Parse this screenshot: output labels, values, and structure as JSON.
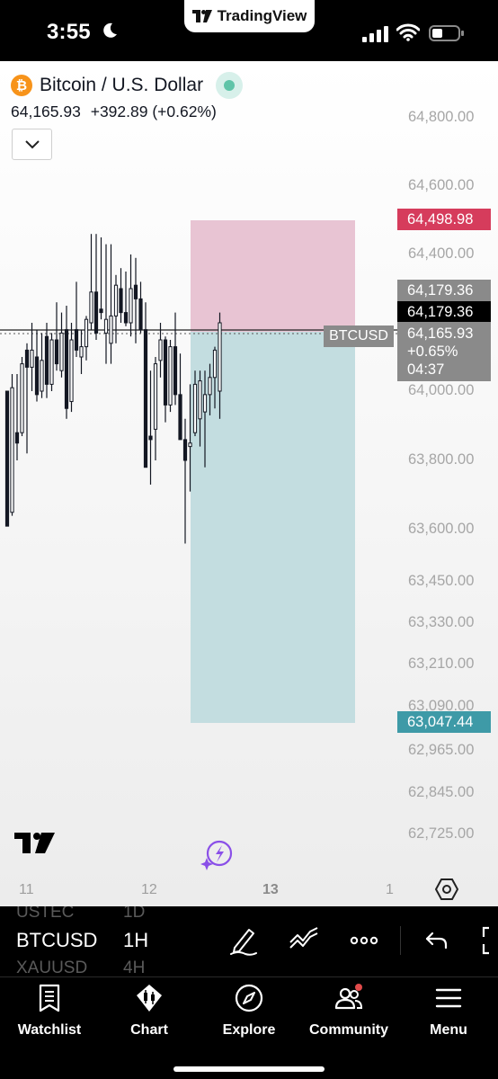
{
  "status_bar": {
    "time": "3:55",
    "app_pill": "TradingView"
  },
  "header": {
    "symbol_name": "Bitcoin / U.S. Dollar",
    "logo_char": "₿",
    "last_price": "64,165.93",
    "change": "+392.89",
    "change_pct": "(+0.62%)"
  },
  "price_axis": [
    "64,800.00",
    "64,600.00",
    "64,400.00",
    "64,000.00",
    "63,800.00",
    "63,600.00",
    "63,450.00",
    "63,330.00",
    "63,210.00",
    "63,090.00",
    "62,965.00",
    "62,845.00",
    "62,725.00"
  ],
  "price_tags": {
    "take_profit": "64,498.98",
    "entry_top": "64,179.36",
    "entry": "64,179.36",
    "current_price": "64,165.93",
    "current_change": "+0.65%",
    "countdown": "04:37",
    "stop_loss": "63,047.44",
    "symbol_tag": "BTCUSD"
  },
  "time_axis": [
    "11",
    "12",
    "13",
    "1"
  ],
  "toolbar": {
    "symbol": "BTCUSD",
    "interval": "1H",
    "ghost_symbol_above": "USTEC",
    "ghost_interval_above": "1D",
    "ghost_symbol_below": "XAUUSD",
    "ghost_interval_below": "4H"
  },
  "nav": {
    "watchlist": "Watchlist",
    "chart": "Chart",
    "explore": "Explore",
    "community": "Community",
    "menu": "Menu"
  },
  "colors": {
    "profit_zone": "#e8c4d3",
    "loss_zone": "#c3dde0",
    "take_profit_tag": "#d63c5c",
    "stop_loss_tag": "#3e9aa7",
    "candle": "#131722",
    "notification_dot": "#e04a4a"
  },
  "chart_data": {
    "type": "candlestick",
    "interval": "1H",
    "ylim": [
      62725,
      64800
    ],
    "last_price": 64165.93,
    "position": {
      "take_profit": 64498.98,
      "entry": 64179.36,
      "stop_loss": 63047.44
    },
    "candles": [
      [
        64000,
        63990,
        63620,
        63610
      ],
      [
        63650,
        64050,
        63640,
        64010
      ],
      [
        63880,
        64050,
        63800,
        63850
      ],
      [
        63880,
        64100,
        63870,
        64080
      ],
      [
        64120,
        64140,
        63820,
        64070
      ],
      [
        64070,
        64200,
        64000,
        64120
      ],
      [
        64100,
        64180,
        63970,
        63990
      ],
      [
        64000,
        64170,
        63980,
        64090
      ],
      [
        64160,
        64200,
        63980,
        64020
      ],
      [
        64020,
        64170,
        64000,
        64150
      ],
      [
        64150,
        64260,
        64060,
        64080
      ],
      [
        64060,
        64230,
        64040,
        64170
      ],
      [
        64180,
        64250,
        63920,
        63950
      ],
      [
        63970,
        64200,
        63940,
        64150
      ],
      [
        64180,
        64320,
        64100,
        64120
      ],
      [
        64100,
        64180,
        64050,
        64130
      ],
      [
        64130,
        64220,
        64090,
        64210
      ],
      [
        64200,
        64460,
        64180,
        64290
      ],
      [
        64290,
        64460,
        64150,
        64170
      ],
      [
        64240,
        64450,
        64210,
        64230
      ],
      [
        64170,
        64430,
        64080,
        64210
      ],
      [
        64140,
        64430,
        64080,
        64220
      ],
      [
        64220,
        64340,
        64140,
        64310
      ],
      [
        64300,
        64360,
        64200,
        64230
      ],
      [
        64230,
        64350,
        64190,
        64200
      ],
      [
        64200,
        64400,
        64160,
        64300
      ],
      [
        64310,
        64390,
        64140,
        64270
      ],
      [
        64270,
        64320,
        64170,
        64180
      ],
      [
        64180,
        64260,
        63800,
        63780
      ],
      [
        63870,
        64060,
        63730,
        63860
      ],
      [
        63890,
        64100,
        63800,
        64080
      ],
      [
        64090,
        64200,
        64040,
        64150
      ],
      [
        64150,
        64160,
        63910,
        63960
      ],
      [
        63960,
        64150,
        63940,
        64130
      ],
      [
        64130,
        64230,
        63960,
        63990
      ],
      [
        63990,
        64110,
        63870,
        63860
      ],
      [
        63860,
        63920,
        63560,
        63800
      ],
      [
        63840,
        64020,
        63710,
        63850
      ],
      [
        63880,
        64060,
        63870,
        64020
      ],
      [
        63920,
        64060,
        63840,
        64030
      ],
      [
        63940,
        64060,
        63780,
        63990
      ],
      [
        63990,
        64080,
        63930,
        64040
      ],
      [
        64040,
        64130,
        63950,
        64120
      ],
      [
        64000,
        64230,
        63920,
        64200
      ]
    ]
  }
}
